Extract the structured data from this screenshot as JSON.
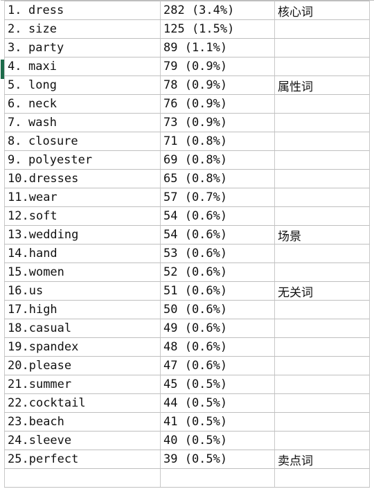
{
  "document": {
    "kind": "spreadsheet-table",
    "active_row_index": 4,
    "active_row_marker_color": "#1d6b4a",
    "grid_line_color": "#c8c8c8",
    "text_color": "#111111",
    "background_color": "#ffffff"
  },
  "columns": [
    {
      "key": "term",
      "header": ""
    },
    {
      "key": "count",
      "header": ""
    },
    {
      "key": "tag",
      "header": ""
    }
  ],
  "rows": [
    {
      "index": "1.",
      "word": "dress",
      "count": "282",
      "percent": "(3.4%)",
      "count_text": "282 (3.4%)",
      "tag": "核心词"
    },
    {
      "index": "2.",
      "word": "size",
      "count": "125",
      "percent": "(1.5%)",
      "count_text": "125 (1.5%)",
      "tag": ""
    },
    {
      "index": "3.",
      "word": "party",
      "count": "89",
      "percent": "(1.1%)",
      "count_text": "89 (1.1%)",
      "tag": ""
    },
    {
      "index": "4.",
      "word": "maxi",
      "count": "79",
      "percent": "(0.9%)",
      "count_text": "79 (0.9%)",
      "tag": ""
    },
    {
      "index": "5.",
      "word": "long",
      "count": "78",
      "percent": "(0.9%)",
      "count_text": "78 (0.9%)",
      "tag": "属性词"
    },
    {
      "index": "6.",
      "word": "neck",
      "count": "76",
      "percent": "(0.9%)",
      "count_text": "76 (0.9%)",
      "tag": ""
    },
    {
      "index": "7.",
      "word": "wash",
      "count": "73",
      "percent": "(0.9%)",
      "count_text": "73 (0.9%)",
      "tag": ""
    },
    {
      "index": "8.",
      "word": "closure",
      "count": "71",
      "percent": "(0.8%)",
      "count_text": "71 (0.8%)",
      "tag": ""
    },
    {
      "index": "9.",
      "word": "polyester",
      "count": "69",
      "percent": "(0.8%)",
      "count_text": "69 (0.8%)",
      "tag": ""
    },
    {
      "index": "10.",
      "word": "dresses",
      "count": "65",
      "percent": "(0.8%)",
      "count_text": "65 (0.8%)",
      "tag": ""
    },
    {
      "index": "11.",
      "word": "wear",
      "count": "57",
      "percent": "(0.7%)",
      "count_text": "57 (0.7%)",
      "tag": ""
    },
    {
      "index": "12.",
      "word": "soft",
      "count": "54",
      "percent": "(0.6%)",
      "count_text": "54 (0.6%)",
      "tag": ""
    },
    {
      "index": "13.",
      "word": "wedding",
      "count": "54",
      "percent": "(0.6%)",
      "count_text": "54 (0.6%)",
      "tag": "场景"
    },
    {
      "index": "14.",
      "word": "hand",
      "count": "53",
      "percent": "(0.6%)",
      "count_text": "53 (0.6%)",
      "tag": ""
    },
    {
      "index": "15.",
      "word": "women",
      "count": "52",
      "percent": "(0.6%)",
      "count_text": "52 (0.6%)",
      "tag": ""
    },
    {
      "index": "16.",
      "word": "us",
      "count": "51",
      "percent": "(0.6%)",
      "count_text": "51 (0.6%)",
      "tag": "无关词"
    },
    {
      "index": "17.",
      "word": "high",
      "count": "50",
      "percent": "(0.6%)",
      "count_text": "50 (0.6%)",
      "tag": ""
    },
    {
      "index": "18.",
      "word": "casual",
      "count": "49",
      "percent": "(0.6%)",
      "count_text": "49 (0.6%)",
      "tag": ""
    },
    {
      "index": "19.",
      "word": "spandex",
      "count": "48",
      "percent": "(0.6%)",
      "count_text": "48 (0.6%)",
      "tag": ""
    },
    {
      "index": "20.",
      "word": "please",
      "count": "47",
      "percent": "(0.6%)",
      "count_text": "47 (0.6%)",
      "tag": ""
    },
    {
      "index": "21.",
      "word": "summer",
      "count": "45",
      "percent": "(0.5%)",
      "count_text": "45 (0.5%)",
      "tag": ""
    },
    {
      "index": "22.",
      "word": "cocktail",
      "count": "44",
      "percent": "(0.5%)",
      "count_text": "44 (0.5%)",
      "tag": ""
    },
    {
      "index": "23.",
      "word": "beach",
      "count": "41",
      "percent": "(0.5%)",
      "count_text": "41 (0.5%)",
      "tag": ""
    },
    {
      "index": "24.",
      "word": "sleeve",
      "count": "40",
      "percent": "(0.5%)",
      "count_text": "40 (0.5%)",
      "tag": ""
    },
    {
      "index": "25.",
      "word": "perfect",
      "count": "39",
      "percent": "(0.5%)",
      "count_text": "39 (0.5%)",
      "tag": "卖点词"
    },
    {
      "index": "",
      "word": "",
      "count": "",
      "percent": "",
      "count_text": "",
      "tag": ""
    }
  ]
}
